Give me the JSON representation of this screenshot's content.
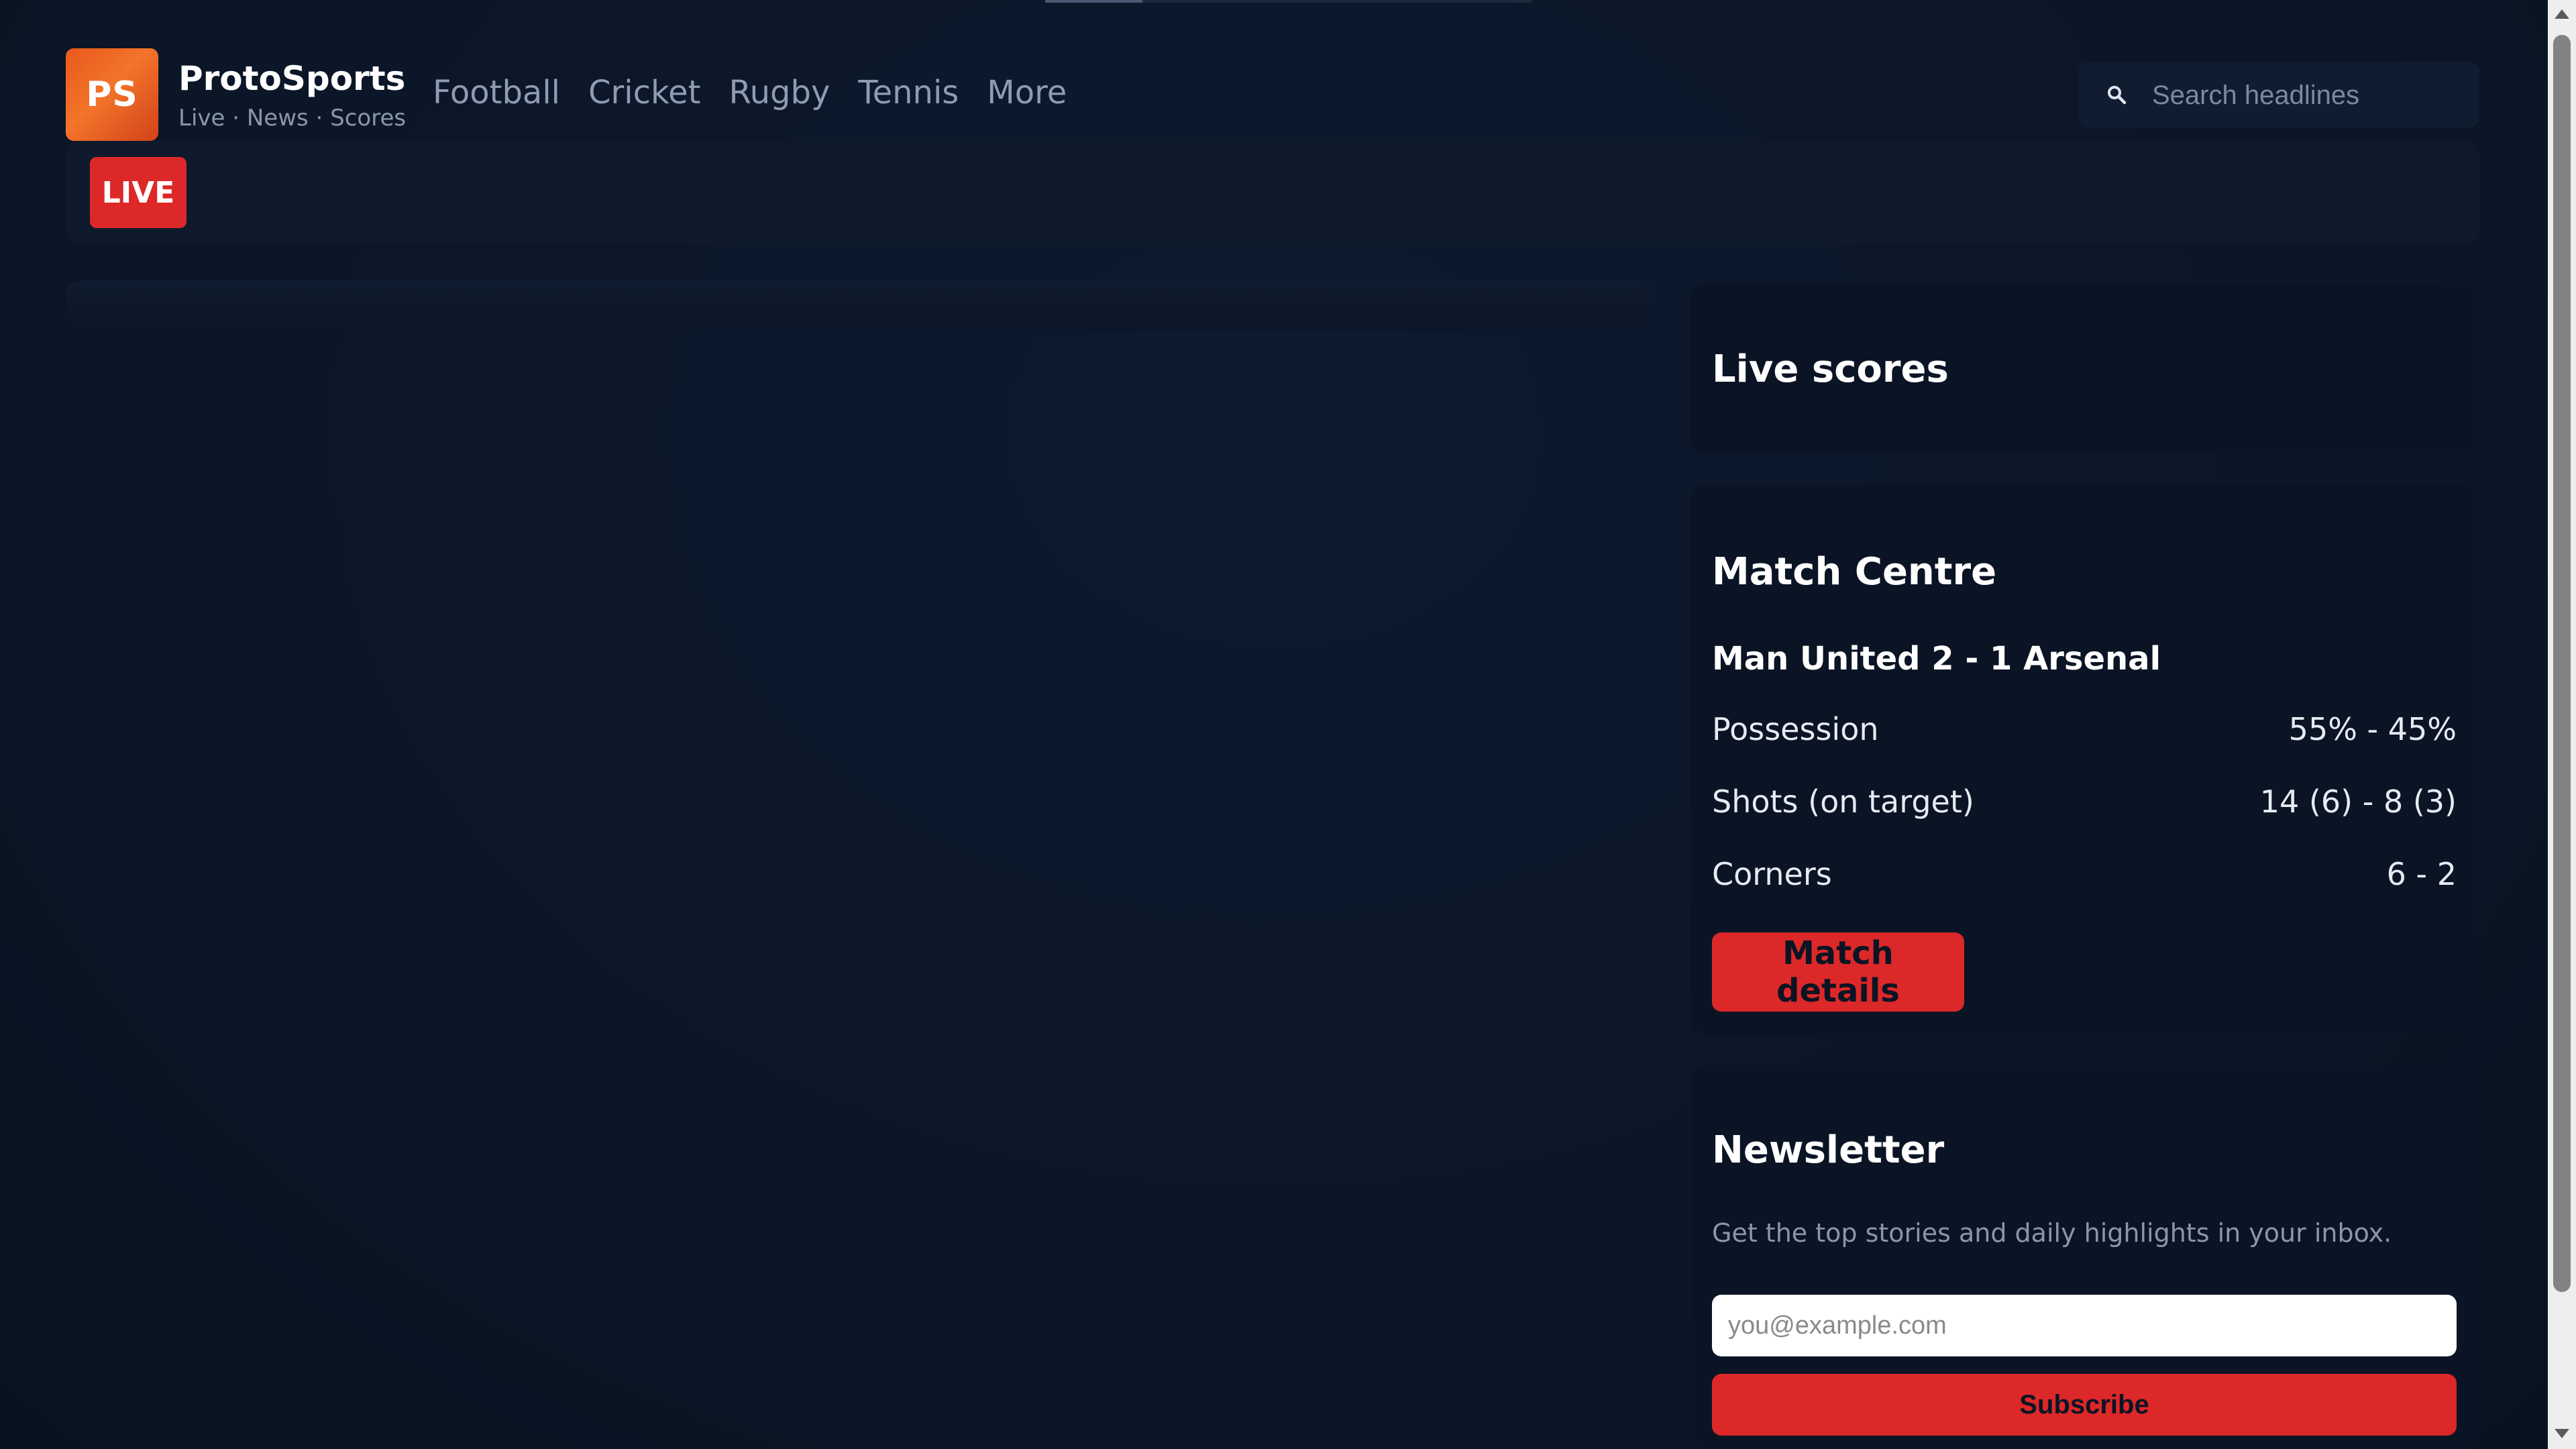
{
  "header": {
    "logo_text": "PS",
    "brand_name": "ProtoSports",
    "brand_tagline": "Live · News · Scores",
    "nav": [
      {
        "label": "Football"
      },
      {
        "label": "Cricket"
      },
      {
        "label": "Rugby"
      },
      {
        "label": "Tennis"
      },
      {
        "label": "More"
      }
    ],
    "search_placeholder": "Search headlines"
  },
  "live_bar": {
    "badge": "LIVE"
  },
  "sidebar": {
    "live_scores_title": "Live scores",
    "match_centre": {
      "title": "Match Centre",
      "score_line": "Man United 2 - 1 Arsenal",
      "stats": [
        {
          "label": "Possession",
          "value": "55% - 45%"
        },
        {
          "label": "Shots (on target)",
          "value": "14 (6) - 8 (3)"
        },
        {
          "label": "Corners",
          "value": "6 - 2"
        }
      ],
      "details_button": "Match details"
    },
    "newsletter": {
      "title": "Newsletter",
      "description": "Get the top stories and daily highlights in your inbox.",
      "email_placeholder": "you@example.com",
      "subscribe_button": "Subscribe"
    }
  },
  "colors": {
    "background": "#0b1628",
    "accent": "#dc2828",
    "logo_orange": "#f3742a"
  }
}
